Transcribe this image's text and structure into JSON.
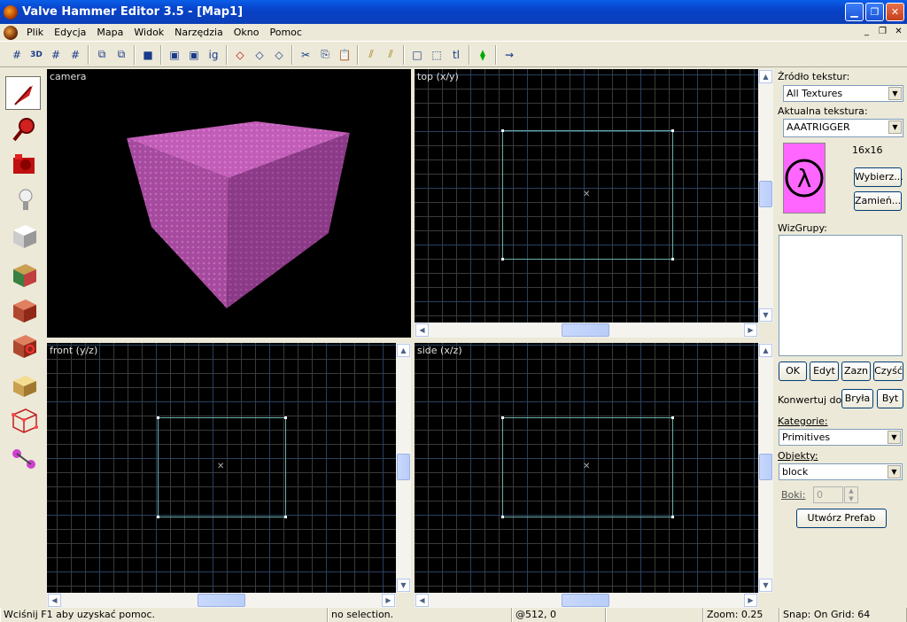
{
  "window": {
    "title": "Valve Hammer Editor 3.5 - [Map1]"
  },
  "menu": [
    "Plik",
    "Edycja",
    "Mapa",
    "Widok",
    "Narzędzia",
    "Okno",
    "Pomoc"
  ],
  "toolbar": {
    "ig_label": "ig",
    "tl_label": "tl"
  },
  "viewports": {
    "camera": "camera",
    "top": "top (x/y)",
    "front": "front (y/z)",
    "side": "side (x/z)"
  },
  "colors": {
    "brush_outline": "#6ab0a8",
    "cube_face": "#a54a9e",
    "grid_major": "#2a4060"
  },
  "panel": {
    "texture_source_label": "Źródło tekstur:",
    "texture_source_value": "All Textures",
    "current_texture_label": "Aktualna tekstura:",
    "current_texture_value": "AAATRIGGER",
    "texture_size": "16x16",
    "browse_button": "Wybierz...",
    "replace_button": "Zamień...",
    "vizgroups_label": "WizGrupy:",
    "ok_button": "OK",
    "edit_button": "Edyt",
    "mark_button": "Zazn",
    "purge_button": "Czyść",
    "convert_label": "Konwertuj do:",
    "to_brush_button": "Bryła",
    "to_entity_button": "Byt",
    "categories_label": "Kategorie:",
    "categories_value": "Primitives",
    "objects_label": "Objekty:",
    "objects_value": "block",
    "faces_label": "Boki:",
    "faces_value": "0",
    "create_prefab_button": "Utwórz Prefab"
  },
  "status": {
    "help": "Wciśnij F1 aby uzyskać pomoc.",
    "selection": "no selection.",
    "coords": "@512, 0",
    "zoom": "Zoom: 0.25",
    "snap": "Snap: On Grid: 64"
  }
}
